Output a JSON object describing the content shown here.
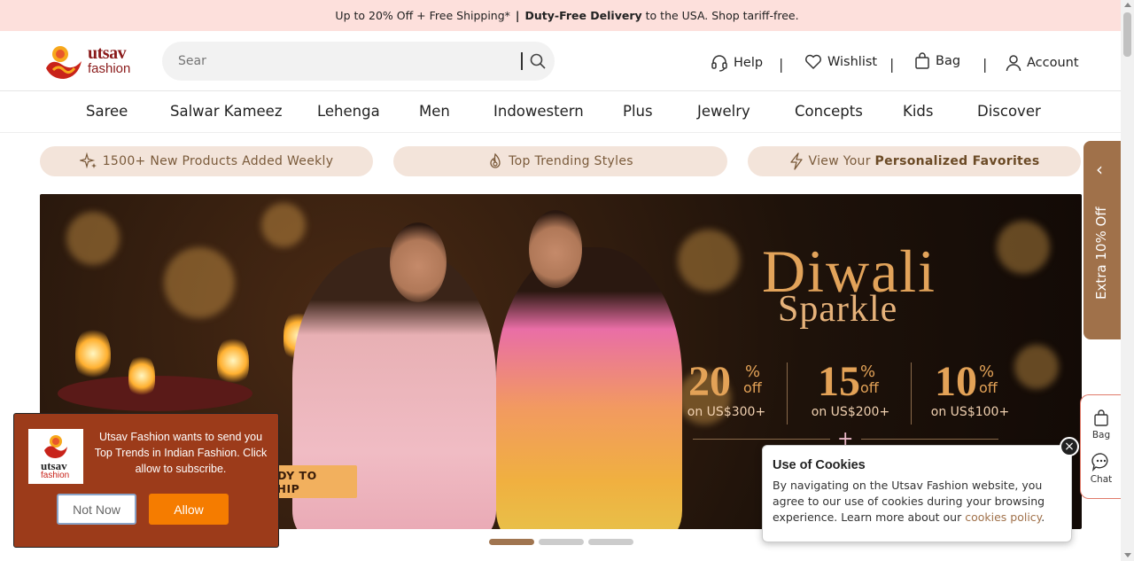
{
  "topbar": {
    "text_pre": "Up to 20% Off + Free Shipping*",
    "sep": "|",
    "text_bold": "Duty-Free Delivery",
    "text_post": " to the USA. Shop tariff-free."
  },
  "header": {
    "logo_line1": "utsav",
    "logo_line2": "fashion",
    "search_placeholder": "Sear",
    "help": "Help",
    "wishlist": "Wishlist",
    "bag": "Bag",
    "account": "Account",
    "separator": "|"
  },
  "categories": [
    "Saree",
    "Salwar Kameez",
    "Lehenga",
    "Men",
    "Indowestern",
    "Plus",
    "Jewelry",
    "Concepts",
    "Kids",
    "Discover"
  ],
  "pills": {
    "new_products": "1500+ New Products Added Weekly",
    "trending": "Top Trending Styles",
    "personalized_pre": "View Your ",
    "personalized_bold": "Personalized Favorites"
  },
  "banner": {
    "title": "Diwali",
    "subtitle": "Sparkle",
    "offers": [
      {
        "value": "20",
        "pct": "%",
        "off": "off",
        "cond": "on US$300+"
      },
      {
        "value": "15",
        "pct": "%",
        "off": "off",
        "cond": "on US$200+"
      },
      {
        "value": "10",
        "pct": "%",
        "off": "off",
        "cond": "on US$100+"
      }
    ],
    "plus": "+",
    "ready_to_ship": "ADY TO SHIP",
    "active_slide": 1,
    "slide_count": 3
  },
  "side_tab": {
    "label": "Extra 10% Off",
    "chevron": "‹"
  },
  "side_box": {
    "bag": "Bag",
    "chat": "Chat"
  },
  "push_prompt": {
    "logo_line1": "utsav",
    "logo_line2": "fashion",
    "message": "Utsav Fashion wants to send you Top Trends in Indian Fashion. Click allow to subscribe.",
    "not_now": "Not Now",
    "allow": "Allow"
  },
  "cookie": {
    "title": "Use of Cookies",
    "body": "By navigating on the Utsav Fashion website, you agree to our use of cookies during your browsing experience. Learn more about our ",
    "link": "cookies policy",
    "end": ".",
    "close": "×"
  },
  "colors": {
    "topbar_bg": "#fde0dc",
    "brand": "#8a1a1a",
    "pill_bg": "#f3e4da",
    "side_tab": "#a0714a",
    "push_bg": "#9c3b1a",
    "allow_btn": "#f57c00"
  }
}
